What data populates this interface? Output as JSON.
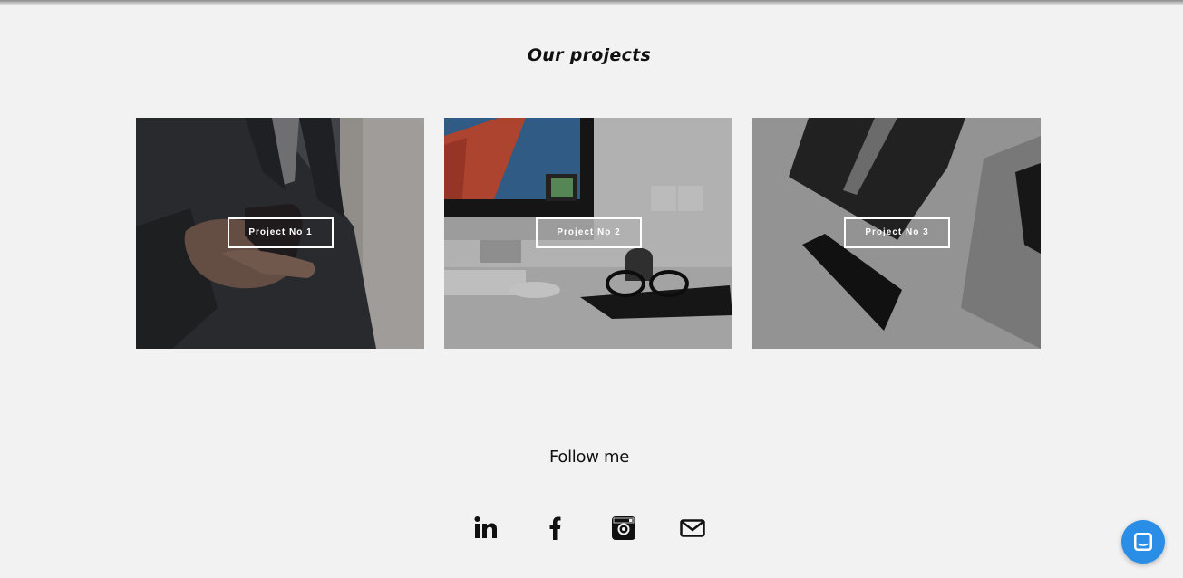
{
  "section": {
    "title": "Our projects"
  },
  "projects": [
    {
      "label": "Project No 1"
    },
    {
      "label": "Project No 2"
    },
    {
      "label": "Project No 3"
    }
  ],
  "social": {
    "title": "Follow me",
    "icons": [
      "linkedin-icon",
      "facebook-icon",
      "instagram-icon",
      "email-icon"
    ]
  },
  "chat": {
    "icon": "chat-icon",
    "color": "#2b8ee6"
  },
  "colors": {
    "background": "#f2f2f2",
    "text": "#111111",
    "overlay_button_border": "#ffffff"
  }
}
